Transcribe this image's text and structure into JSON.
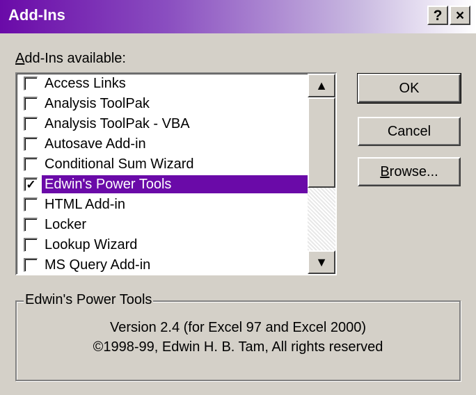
{
  "window": {
    "title": "Add-Ins",
    "help_label": "?",
    "close_label": "×"
  },
  "list_label": {
    "accel": "A",
    "rest": "dd-Ins available:"
  },
  "addins": [
    {
      "label": "Access Links",
      "checked": false
    },
    {
      "label": "Analysis ToolPak",
      "checked": false
    },
    {
      "label": "Analysis ToolPak - VBA",
      "checked": false
    },
    {
      "label": "Autosave Add-in",
      "checked": false
    },
    {
      "label": "Conditional Sum Wizard",
      "checked": false
    },
    {
      "label": "Edwin's Power Tools",
      "checked": true,
      "selected": true
    },
    {
      "label": "HTML Add-in",
      "checked": false
    },
    {
      "label": "Locker",
      "checked": false
    },
    {
      "label": "Lookup Wizard",
      "checked": false
    },
    {
      "label": "MS Query Add-in",
      "checked": false
    }
  ],
  "scrollbar": {
    "up_glyph": "▲",
    "down_glyph": "▼"
  },
  "buttons": {
    "ok": "OK",
    "cancel": "Cancel",
    "browse_accel": "B",
    "browse_rest": "rowse..."
  },
  "details": {
    "title": "Edwin's Power Tools",
    "line1": "Version 2.4 (for Excel 97 and Excel 2000)",
    "line2": "©1998-99, Edwin H. B. Tam, All rights reserved"
  },
  "colors": {
    "selection": "#6a0aa8",
    "face": "#d4d0c8"
  }
}
